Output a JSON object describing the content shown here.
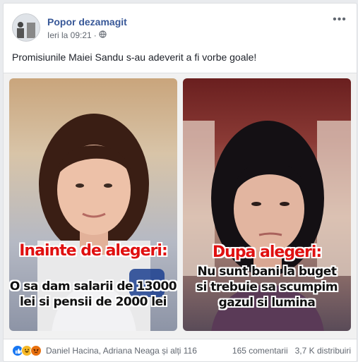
{
  "post": {
    "page_name": "Popor dezamagit",
    "timestamp": "Ieri la 09:21",
    "privacy_icon": "globe-icon",
    "more_icon": "more-options-icon",
    "text": "Promisiunile Maiei Sandu s-au adeverit a fi vorbe goale!"
  },
  "image": {
    "left": {
      "heading": "Inainte de alegeri:",
      "body_lines": [
        "O sa dam salarii de 13000",
        "lei si pensii de 2000 lei"
      ]
    },
    "right": {
      "heading": "Dupa alegeri:",
      "body_lines": [
        "Nu sunt bani la buget",
        "si trebuie sa scumpim",
        "gazul si lumina"
      ]
    }
  },
  "footer": {
    "reactions": [
      "like-icon",
      "haha-icon",
      "angry-icon"
    ],
    "reactors": "Daniel Hacina, Adriana Neaga și alți 116",
    "comments": "165 comentarii",
    "shares": "3,7 K distribuiri"
  },
  "colors": {
    "link_blue": "#385898",
    "heading_red": "#e01010",
    "like_blue": "#1877f2"
  }
}
